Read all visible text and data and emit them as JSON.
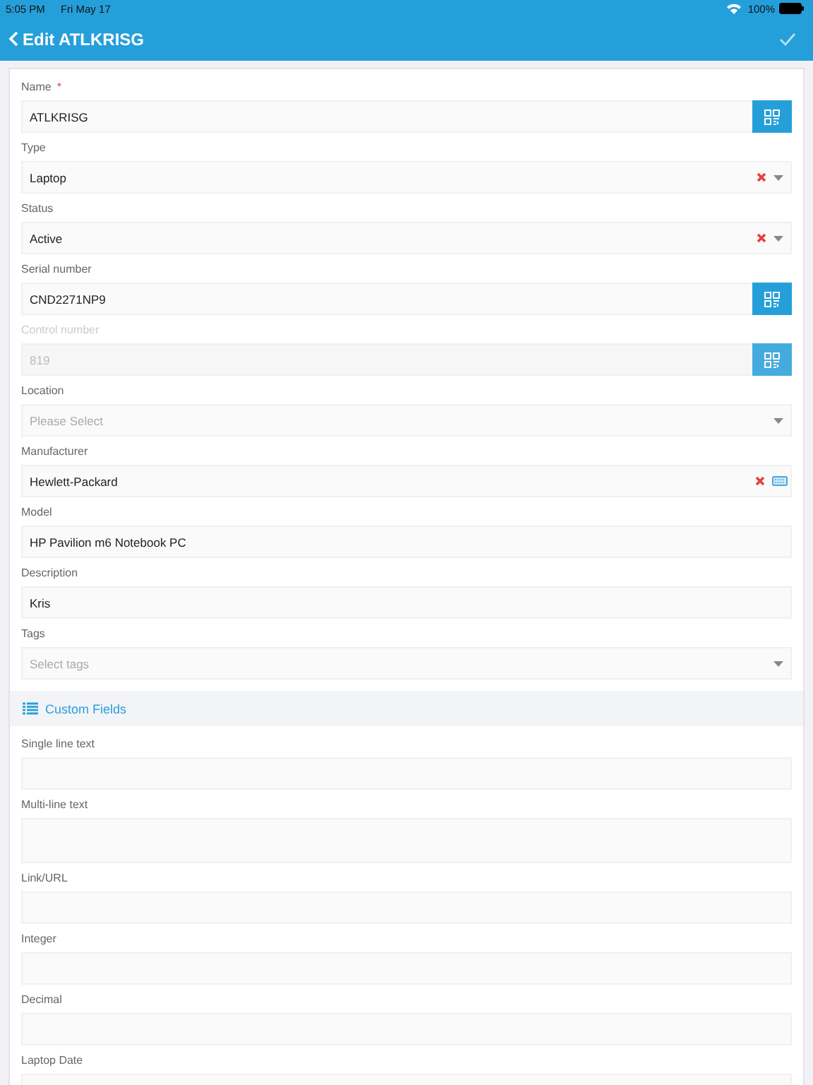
{
  "status_bar": {
    "time": "5:05 PM",
    "date": "Fri May 17",
    "battery": "100%"
  },
  "header": {
    "back_label": "Edit ATLKRISG"
  },
  "fields": [
    {
      "kind": "text",
      "label": "Name",
      "required_mark": "*",
      "value": "ATLKRISG",
      "clearable": false,
      "scan": true,
      "keyboard": false,
      "disabled": false
    },
    {
      "kind": "select",
      "label": "Type",
      "value": "Laptop",
      "clearable": true,
      "scan": false,
      "keyboard": false,
      "disabled": false
    },
    {
      "kind": "select",
      "label": "Status",
      "value": "Active",
      "clearable": true,
      "scan": false,
      "keyboard": false,
      "disabled": false
    },
    {
      "kind": "text",
      "label": "Serial number",
      "value": "CND2271NP9",
      "clearable": false,
      "scan": true,
      "keyboard": false,
      "disabled": false
    },
    {
      "kind": "text",
      "label": "Control number",
      "value": "819",
      "clearable": false,
      "scan": true,
      "keyboard": false,
      "disabled": true
    },
    {
      "kind": "select",
      "label": "Location",
      "placeholder": "Please Select",
      "clearable": false,
      "scan": false,
      "keyboard": false,
      "disabled": false
    },
    {
      "kind": "text",
      "label": "Manufacturer",
      "value": "Hewlett-Packard",
      "clearable": true,
      "scan": false,
      "keyboard": true,
      "disabled": false
    },
    {
      "kind": "text",
      "label": "Model",
      "value": "HP Pavilion m6 Notebook PC",
      "clearable": false,
      "scan": false,
      "keyboard": false,
      "disabled": false
    },
    {
      "kind": "text",
      "label": "Description",
      "value": "Kris",
      "clearable": false,
      "scan": false,
      "keyboard": false,
      "disabled": false
    },
    {
      "kind": "select",
      "label": "Tags",
      "placeholder": "Select tags",
      "clearable": false,
      "scan": false,
      "keyboard": false,
      "disabled": false
    }
  ],
  "custom_section": {
    "title": "Custom Fields"
  },
  "custom_fields": [
    {
      "kind": "text",
      "label": "Single line text"
    },
    {
      "kind": "textarea",
      "label": "Multi-line text"
    },
    {
      "kind": "text",
      "label": "Link/URL"
    },
    {
      "kind": "text",
      "label": "Integer"
    },
    {
      "kind": "text",
      "label": "Decimal"
    },
    {
      "kind": "text",
      "label": "Laptop Date"
    }
  ]
}
